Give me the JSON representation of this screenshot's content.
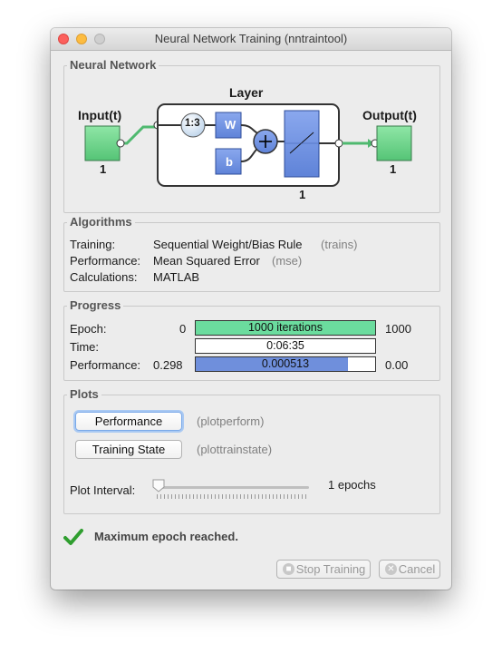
{
  "window": {
    "title": "Neural Network Training (nntraintool)"
  },
  "network": {
    "section_title": "Neural Network",
    "input_label": "Input(t)",
    "input_size": "1",
    "layer_label": "Layer",
    "delay_label": "1:3",
    "weight_label": "W",
    "bias_label": "b",
    "layer_size": "1",
    "output_label": "Output(t)",
    "output_size": "1"
  },
  "algorithms": {
    "section_title": "Algorithms",
    "rows": [
      {
        "label": "Training:",
        "value": "Sequential Weight/Bias Rule",
        "func": "(trains)"
      },
      {
        "label": "Performance:",
        "value": "Mean Squared Error",
        "func": "(mse)"
      },
      {
        "label": "Calculations:",
        "value": "MATLAB",
        "func": ""
      }
    ]
  },
  "progress": {
    "section_title": "Progress",
    "epoch": {
      "label": "Epoch:",
      "start": "0",
      "bar_text": "1000 iterations",
      "end": "1000",
      "fraction": 1.0
    },
    "time": {
      "label": "Time:",
      "bar_text": "0:06:35"
    },
    "performance": {
      "label": "Performance:",
      "start": "0.298",
      "bar_text": "0.000513",
      "end": "0.00",
      "fraction": 0.85
    }
  },
  "plots": {
    "section_title": "Plots",
    "buttons": [
      {
        "label": "Performance",
        "func": "(plotperform)"
      },
      {
        "label": "Training State",
        "func": "(plottrainstate)"
      }
    ],
    "interval_label": "Plot Interval:",
    "interval_value": "1 epochs"
  },
  "status": {
    "message": "Maximum epoch reached.",
    "icon": "checkmark-icon"
  },
  "footer": {
    "stop_label": "Stop Training",
    "cancel_label": "Cancel"
  },
  "colors": {
    "accent_green": "#6bdc9e",
    "perf_blue": "#6f8fdc",
    "block_blue": "#7396e3",
    "io_green": "#6fd489"
  }
}
